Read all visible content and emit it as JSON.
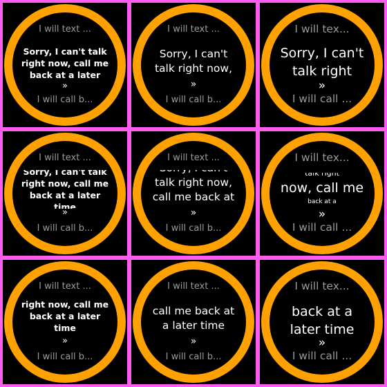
{
  "colors": {
    "accent": "#ffa100",
    "grid": "#ff5cf0",
    "background": "#000000"
  },
  "frames": [
    {
      "size": "small",
      "top_label": "I will text ...",
      "bottom_label": "I will call b...",
      "message_lines": [
        "Sorry, I can't talk",
        "right now, call me",
        "back at a later"
      ],
      "more": "»"
    },
    {
      "size": "medium",
      "top_label": "I will text ...",
      "bottom_label": "I will call b...",
      "message_lines": [
        "Sorry, I can't",
        "talk right now,"
      ],
      "more": "»"
    },
    {
      "size": "large",
      "top_label": "I will tex...",
      "bottom_label": "I will call ...",
      "message_lines": [
        "Sorry, I can't",
        "talk right"
      ],
      "more": "»"
    },
    {
      "size": "small",
      "top_label": "I will text ...",
      "bottom_label": "I will call b...",
      "message_lines": [
        "Sorry, I can't talk",
        "right now, call me",
        "back at a later",
        "time"
      ],
      "more": "»"
    },
    {
      "size": "medium",
      "top_label": "I will text ...",
      "bottom_label": "I will call b...",
      "message_lines": [
        "Sorry, I can't",
        "talk right now,",
        "call me back at"
      ],
      "more": "»"
    },
    {
      "size": "large",
      "top_label": "I will tex...",
      "bottom_label": "I will call ...",
      "message_lines": [
        "talk right",
        "now, call me",
        "back at a"
      ],
      "more": "»"
    },
    {
      "size": "small",
      "top_label": "I will text ...",
      "bottom_label": "I will call b...",
      "message_lines": [
        "right now, call me",
        "back at a later",
        "time"
      ],
      "more": "»"
    },
    {
      "size": "medium",
      "top_label": "I will text ...",
      "bottom_label": "I will call b...",
      "message_lines": [
        "call me back at",
        "a later time"
      ],
      "more": "»"
    },
    {
      "size": "large",
      "top_label": "I will tex...",
      "bottom_label": "I will call ...",
      "message_lines": [
        "back at a",
        "later time"
      ],
      "more": "»"
    }
  ]
}
